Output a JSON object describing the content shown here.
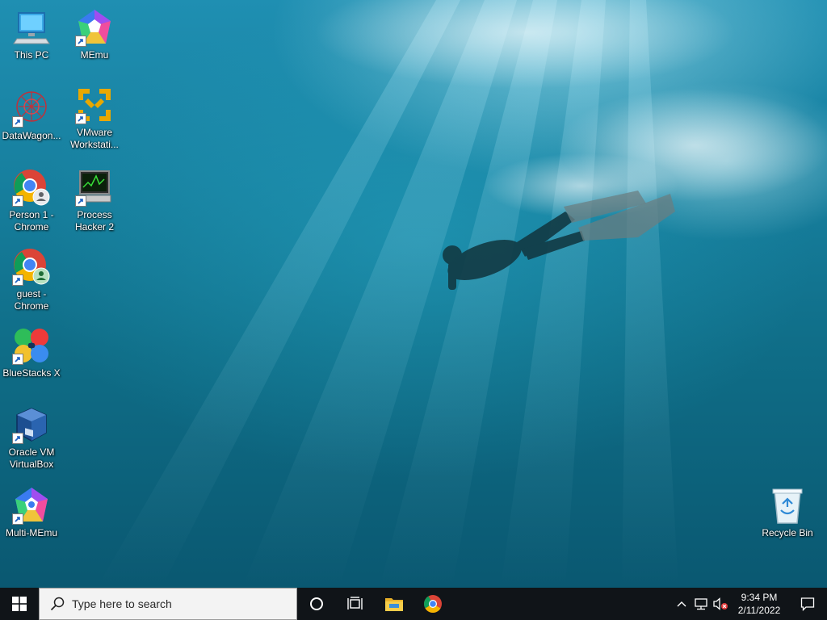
{
  "desktop": {
    "icons": [
      {
        "label": "This PC",
        "icon": "computer-icon"
      },
      {
        "label": "MEmu",
        "icon": "memu-icon"
      },
      {
        "label": "DataWagon...",
        "icon": "datawagon-icon"
      },
      {
        "label": "VMware\nWorkstati...",
        "icon": "vmware-icon"
      },
      {
        "label": "Person 1 -\nChrome",
        "icon": "chrome-profile-icon"
      },
      {
        "label": "Process\nHacker 2",
        "icon": "process-hacker-icon"
      },
      {
        "label": "guest -\nChrome",
        "icon": "chrome-profile-icon"
      },
      {
        "label": "BlueStacks X",
        "icon": "bluestacks-icon"
      },
      {
        "label": "Oracle VM\nVirtualBox",
        "icon": "virtualbox-icon"
      },
      {
        "label": "Multi-MEmu",
        "icon": "multi-memu-icon"
      },
      {
        "label": "Recycle Bin",
        "icon": "recycle-bin-icon"
      }
    ]
  },
  "taskbar": {
    "search_placeholder": "Type here to search",
    "pinned": [
      "cortana-icon",
      "task-view-icon",
      "file-explorer-icon",
      "chrome-icon"
    ],
    "tray": {
      "icons": [
        "show-hidden-icons-chevron-icon",
        "network-icon",
        "volume-muted-icon"
      ],
      "time": "9:34 PM",
      "date": "2/11/2022"
    },
    "notification_icon": "action-center-icon"
  },
  "colors": {
    "taskbar_bg": "#101418",
    "search_bg": "#f3f3f3",
    "water_light": "#1f8fb2",
    "water_dark": "#0a5871"
  }
}
